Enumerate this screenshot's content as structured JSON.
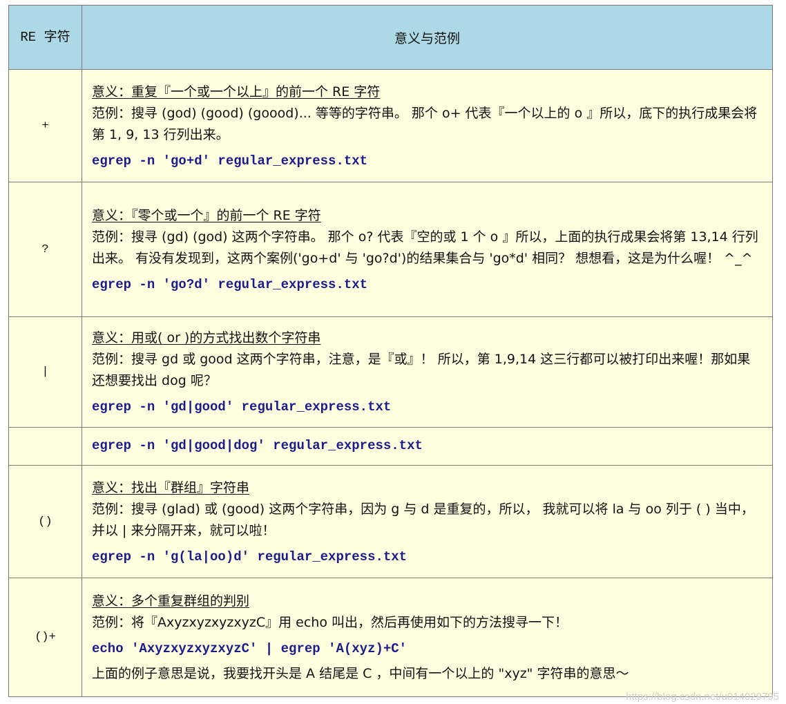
{
  "header": {
    "symbol_col": "RE 字符",
    "meaning_col": "意义与范例"
  },
  "rows": [
    {
      "symbol": "+",
      "meaning": "意义：重复『一个或一个以上』的前一个 RE 字符",
      "example": "范例：搜寻 (god) (good) (goood)... 等等的字符串。 那个 o+ 代表『一个以上的 o 』所以，底下的执行成果会将第 1, 9, 13 行列出来。",
      "command": "egrep -n 'go+d' regular_express.txt"
    },
    {
      "symbol": "?",
      "meaning": "意义：『零个或一个』的前一个 RE 字符",
      "example": "范例：搜寻 (gd) (god) 这两个字符串。 那个 o? 代表『空的或 1 个 o 』所以，上面的执行成果会将第 13,14 行列出来。 有没有发现到，这两个案例('go+d' 与 'go?d')的结果集合与 'go*d' 相同？ 想想看，这是为什么喔！ ^_^",
      "command": "egrep -n 'go?d' regular_express.txt"
    },
    {
      "symbol": "|",
      "meaning": "意义：用或( or )的方式找出数个字符串",
      "example": "范例：搜寻 gd 或 good 这两个字符串，注意，是『或』！ 所以，第 1,9,14 这三行都可以被打印出来喔！那如果还想要找出 dog 呢？",
      "command": "egrep -n 'gd|good' regular_express.txt"
    },
    {
      "symbol": "",
      "command": "egrep -n 'gd|good|dog' regular_express.txt"
    },
    {
      "symbol": "()",
      "meaning": "意义：找出『群组』字符串",
      "example": "范例：搜寻 (glad) 或 (good) 这两个字符串，因为 g 与 d 是重复的，所以， 我就可以将 la 与 oo 列于 ( ) 当中，并以 | 来分隔开来，就可以啦！",
      "command": "egrep -n 'g(la|oo)d' regular_express.txt"
    },
    {
      "symbol": "()+",
      "meaning": "意义：多个重复群组的判别",
      "example": "范例：将『AxyzxyzxyzxyzC』用 echo 叫出，然后再使用如下的方法搜寻一下！",
      "command": "echo 'AxyzxyzxyzxyzC' | egrep 'A(xyz)+C'",
      "tail": "上面的例子意思是说，我要找开头是 A 结尾是 C ，中间有一个以上的 \"xyz\" 字符串的意思～"
    }
  ],
  "watermark": "https://blog.csdn.net/u014029795"
}
